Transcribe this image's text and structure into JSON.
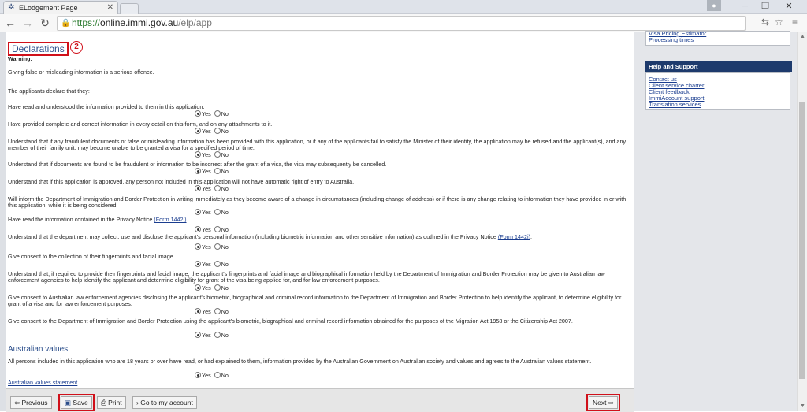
{
  "browser": {
    "tab_title": "ELodgement Page",
    "url_protocol": "https://",
    "url_host": "online.immi.gov.au",
    "url_path": "/elp/app"
  },
  "declarations": {
    "title": "Declarations",
    "annotation": "2",
    "warning_label": "Warning:",
    "warning_text": "Giving false or misleading information is a serious offence.",
    "intro": "The applicants declare that they:",
    "yes_label": "Yes",
    "no_label": "No",
    "items": [
      {
        "text": "Have read and understood the information provided to them in this application."
      },
      {
        "text": "Have provided complete and correct information in every detail on this form, and on any attachments to it."
      },
      {
        "text": "Understand that if any fraudulent documents or false or misleading information has been provided with this application, or if any of the applicants fail to satisfy the Minister of their identity, the application may be refused and the applicant(s), and any member of their family unit, may become unable to be granted a visa for a specified period of time."
      },
      {
        "text": "Understand that if documents are found to be fraudulent or information to be incorrect after the grant of a visa, the visa may subsequently be cancelled."
      },
      {
        "text": "Understand that if this application is approved, any person not included in this application will not have automatic right of entry to Australia."
      },
      {
        "text": "Will inform the Department of Immigration and Border Protection in writing immediately as they become aware of a change in circumstances (including change of address) or if there is any change relating to information they have provided in or with this application, while it is being considered."
      },
      {
        "text": "Have read the information contained in the Privacy Notice",
        "link": "(Form 1442i)",
        "suffix": "."
      },
      {
        "text": "Understand that the department may collect, use and disclose the applicant's personal information (including biometric information and other sensitive information) as outlined in the Privacy Notice",
        "link": "(Form 1442i)",
        "suffix": "."
      },
      {
        "text": "Give consent to the collection of their fingerprints and facial image."
      },
      {
        "text": "Understand that, if required to provide their fingerprints and facial image, the applicant's fingerprints and facial image and biographical information held by the Department of Immigration and Border Protection may be given to Australian law enforcement agencies to help identify the applicant and determine eligibility for grant of the visa being applied for, and for law enforcement purposes."
      },
      {
        "text": "Give consent to Australian law enforcement agencies disclosing the applicant's biometric, biographical and criminal record information to the Department of Immigration and Border Protection to help identify the applicant, to determine eligibility for grant of a visa and for law enforcement purposes."
      },
      {
        "text": "Give consent to the Department of Immigration and Border Protection using the applicant's biometric, biographical and criminal record information obtained for the purposes of the Migration Act 1958 or the Citizenship Act 2007."
      }
    ]
  },
  "australian_values": {
    "title": "Australian values",
    "text": "All persons included in this application who are 18 years or over have read, or had explained to them, information provided by the Australian Government on Australian society and values and agrees to the Australian values statement.",
    "link": "Australian values statement"
  },
  "toolbar": {
    "previous": "Previous",
    "save": "Save",
    "print": "Print",
    "account": "Go to my account",
    "next": "Next"
  },
  "sidebar": {
    "top_links": [
      "Visa Pricing Estimator",
      "Processing times"
    ],
    "help_title": "Help and Support",
    "help_links": [
      "Contact us",
      "Client service charter",
      "Client feedback",
      "ImmiAccount support",
      "Translation services"
    ]
  },
  "colors": {
    "accent": "#1d3a6c",
    "highlight": "#d0101a",
    "link": "#1a3d8f"
  }
}
